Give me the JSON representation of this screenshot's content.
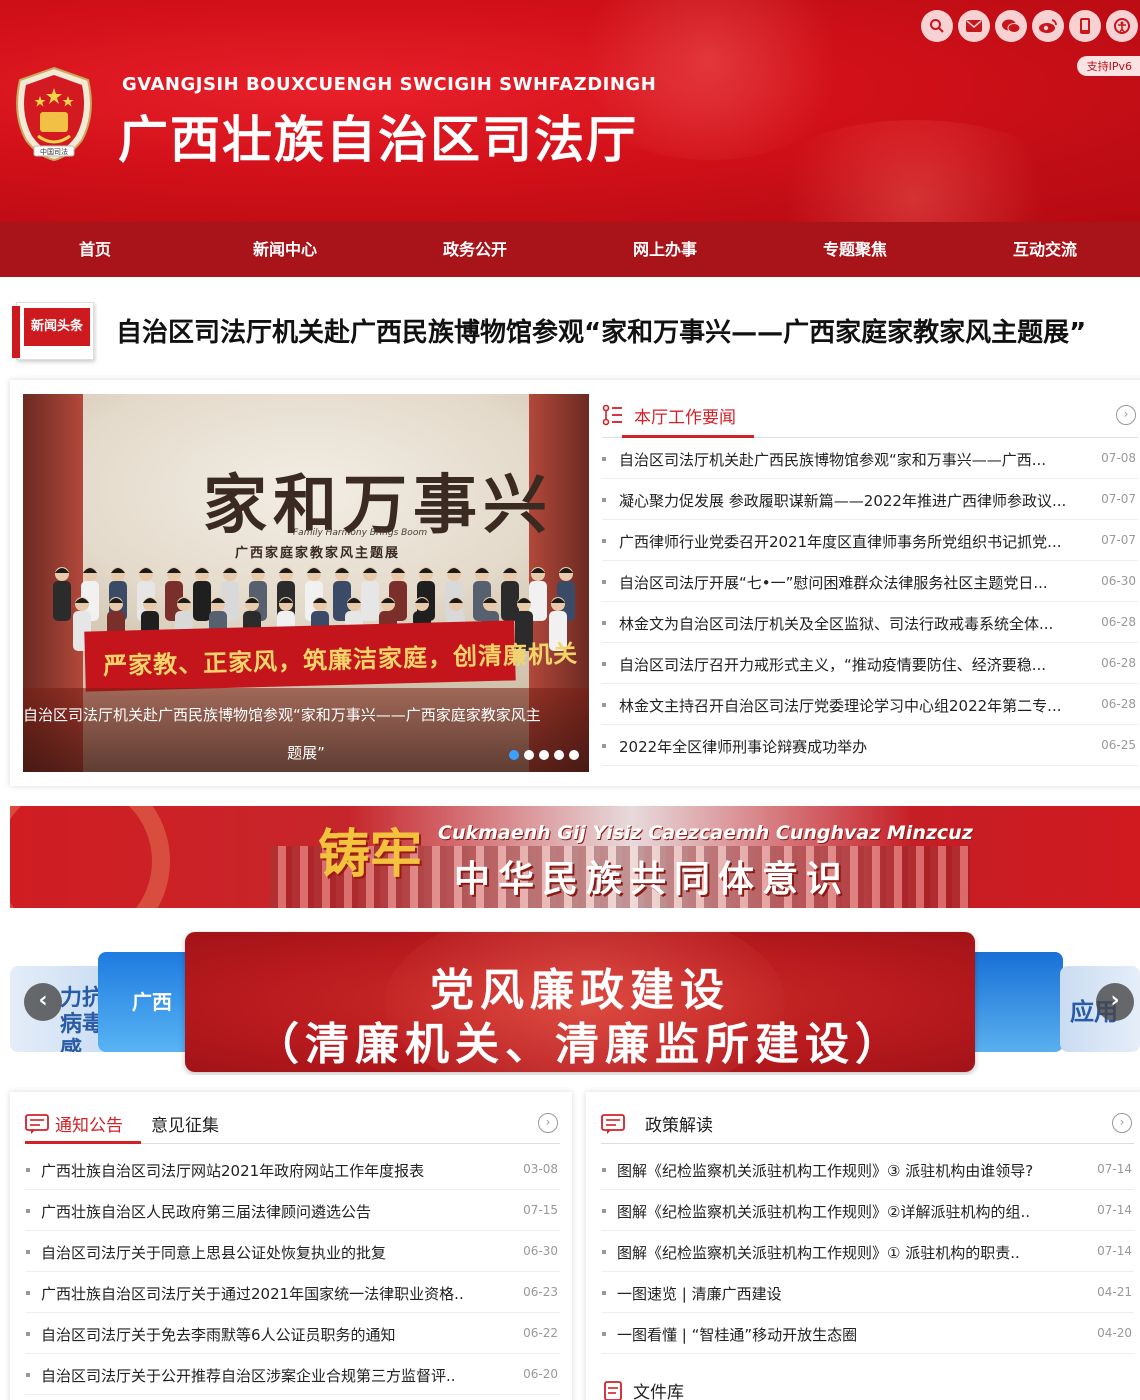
{
  "header": {
    "pinyin": "GVANGJSIH BOUXCUENGH SWCIGIH SWHFAZDINGH",
    "title": "广西壮族自治区司法厅",
    "emblem_text": "中国司法",
    "ipv6": "支持IPv6",
    "icons": [
      "search-icon",
      "mail-icon",
      "wechat-icon",
      "weibo-icon",
      "mobile-icon",
      "accessibility-icon"
    ],
    "brand_color": "#d21019"
  },
  "nav": [
    "首页",
    "新闻中心",
    "政务公开",
    "网上办事",
    "专题聚焦",
    "互动交流"
  ],
  "headline": {
    "badge": "新闻头条",
    "text": "自治区司法厅机关赴广西民族博物馆参观“家和万事兴——广西家庭家教家风主题展”"
  },
  "slider": {
    "calligraphy": "家和万事兴",
    "sub_en": "Family Harmony Brings Boom",
    "sub_zh": "广西家庭家教家风主题展",
    "banner": "严家教、正家风，筑廉洁家庭，创清廉机关",
    "caption_line1": "自治区司法厅机关赴广西民族博物馆参观“家和万事兴——广西家庭家教家风主",
    "caption_line2": "题展”",
    "dots": 5,
    "active_dot": 0
  },
  "work_news": {
    "title": "本厅工作要闻",
    "items": [
      {
        "text": "自治区司法厅机关赴广西民族博物馆参观“家和万事兴——广西...",
        "date": "07-08"
      },
      {
        "text": "凝心聚力促发展 参政履职谋新篇——2022年推进广西律师参政议...",
        "date": "07-07"
      },
      {
        "text": "广西律师行业党委召开2021年度区直律师事务所党组织书记抓党...",
        "date": "07-07"
      },
      {
        "text": "自治区司法厅开展“七•一”慰问困难群众法律服务社区主题党日...",
        "date": "06-30"
      },
      {
        "text": "林金文为自治区司法厅机关及全区监狱、司法行政戒毒系统全体...",
        "date": "06-28"
      },
      {
        "text": "自治区司法厅召开力戒形式主义，“推动疫情要防住、经济要稳...",
        "date": "06-28"
      },
      {
        "text": "林金文主持召开自治区司法厅党委理论学习中心组2022年第二专...",
        "date": "06-28"
      },
      {
        "text": "2022年全区律师刑事论辩赛成功举办",
        "date": "06-25"
      }
    ]
  },
  "ribbon": {
    "zhuo": "铸牢",
    "latin": "Cukmaenh Gij Yisiz Caezcaemh Cunghvaz Minzcuz",
    "zh": "中华民族共同体意识"
  },
  "carousel": {
    "main_line1": "党风廉政建设",
    "main_line2": "（清廉机关、清廉监所建设）",
    "left_far": "力抗 病毒感",
    "left_near": "广西",
    "right_far": "应用"
  },
  "notice": {
    "tab1": "通知公告",
    "tab2": "意见征集",
    "items": [
      {
        "text": "广西壮族自治区司法厅网站2021年政府网站工作年度报表",
        "date": "03-08"
      },
      {
        "text": "广西壮族自治区人民政府第三届法律顾问遴选公告",
        "date": "07-15"
      },
      {
        "text": "自治区司法厅关于同意上思县公证处恢复执业的批复",
        "date": "06-30"
      },
      {
        "text": "广西壮族自治区司法厅关于通过2021年国家统一法律职业资格..",
        "date": "06-23"
      },
      {
        "text": "自治区司法厅关于免去李雨默等6人公证员职务的通知",
        "date": "06-22"
      },
      {
        "text": "自治区司法厅关于公开推荐自治区涉案企业合规第三方监督评..",
        "date": "06-20"
      }
    ]
  },
  "policy": {
    "title": "政策解读",
    "items": [
      {
        "text": "图解《纪检监察机关派驻机构工作规则》③ 派驻机构由谁领导?",
        "date": "07-14"
      },
      {
        "text": "图解《纪检监察机关派驻机构工作规则》②详解派驻机构的组..",
        "date": "07-14"
      },
      {
        "text": "图解《纪检监察机关派驻机构工作规则》① 派驻机构的职责..",
        "date": "07-14"
      },
      {
        "text": "一图速览 | 清廉广西建设",
        "date": "04-21"
      },
      {
        "text": "一图看懂 | “智桂通”移动开放生态圈",
        "date": "04-20"
      }
    ],
    "file_library": "文件库"
  }
}
